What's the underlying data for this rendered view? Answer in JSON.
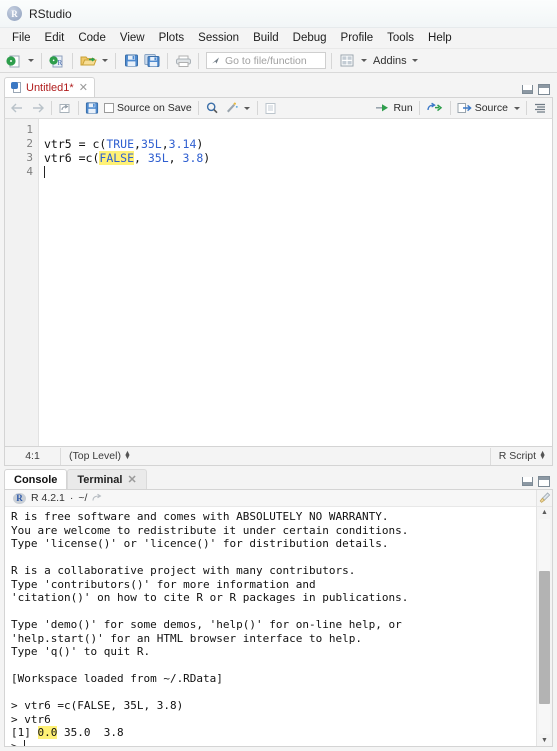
{
  "window": {
    "title": "RStudio",
    "logo_letter": "R"
  },
  "menubar": {
    "items": [
      "File",
      "Edit",
      "Code",
      "View",
      "Plots",
      "Session",
      "Build",
      "Debug",
      "Profile",
      "Tools",
      "Help"
    ]
  },
  "toolbar": {
    "new_file_icon": "new-file-icon",
    "new_project_icon": "new-project-icon",
    "open_file_icon": "open-folder-icon",
    "save_icon": "save-icon",
    "save_all_icon": "save-all-icon",
    "print_icon": "print-icon",
    "goto_placeholder": "Go to file/function",
    "goto_value": "",
    "workspace_panes_icon": "grid-panes-icon",
    "addins_label": "Addins"
  },
  "source_pane": {
    "tab": {
      "label": "Untitled1*",
      "icon": "r-script-doc-icon",
      "close_icon": "close-icon"
    },
    "window_controls": {
      "minimize": "minimize-icon",
      "maximize": "maximize-icon"
    },
    "editor_toolbar": {
      "back_icon": "back-arrow-icon",
      "forward_icon": "forward-arrow-icon",
      "popout_icon": "show-in-new-window-icon",
      "save_icon": "save-icon",
      "source_on_save_label": "Source on Save",
      "find_icon": "search-icon",
      "magic_icon": "code-tools-icon",
      "compile_report_icon": "compile-report-icon",
      "run_label": "Run",
      "rerun_icon": "rerun-icon",
      "source_label": "Source",
      "outline_icon": "document-outline-icon"
    },
    "code_lines": [
      {
        "num": "1",
        "tokens": []
      },
      {
        "num": "2",
        "tokens": [
          {
            "t": "vtr5 = c(",
            "c": "plain"
          },
          {
            "t": "TRUE",
            "c": "logical"
          },
          {
            "t": ",",
            "c": "plain"
          },
          {
            "t": "35L",
            "c": "num"
          },
          {
            "t": ",",
            "c": "plain"
          },
          {
            "t": "3.14",
            "c": "num"
          },
          {
            "t": ")",
            "c": "plain"
          }
        ]
      },
      {
        "num": "3",
        "tokens": [
          {
            "t": "vtr6 =c(",
            "c": "plain"
          },
          {
            "t": "FALSE",
            "c": "logical-highlight"
          },
          {
            "t": ", ",
            "c": "plain"
          },
          {
            "t": "35L",
            "c": "num"
          },
          {
            "t": ", ",
            "c": "plain"
          },
          {
            "t": "3.8",
            "c": "num"
          },
          {
            "t": ")",
            "c": "plain"
          }
        ]
      },
      {
        "num": "4",
        "tokens": [
          {
            "t": "cursor",
            "c": "caret"
          }
        ]
      }
    ],
    "status": {
      "cursor_position": "4:1",
      "scope": "(Top Level)",
      "file_type": "R Script"
    }
  },
  "console_pane": {
    "tabs": [
      {
        "label": "Console",
        "active": true
      },
      {
        "label": "Terminal",
        "active": false,
        "close_icon": "close-icon"
      }
    ],
    "window_controls": {
      "minimize": "minimize-icon",
      "maximize": "maximize-icon"
    },
    "header": {
      "logo": "R",
      "version": "R 4.2.1",
      "separator": "·",
      "working_dir": "~/",
      "popout_icon": "open-in-window-icon"
    },
    "clear_icon": "broom-clear-console-icon",
    "output": [
      "R is free software and comes with ABSOLUTELY NO WARRANTY.",
      "You are welcome to redistribute it under certain conditions.",
      "Type 'license()' or 'licence()' for distribution details.",
      "",
      "R is a collaborative project with many contributors.",
      "Type 'contributors()' for more information and",
      "'citation()' on how to cite R or R packages in publications.",
      "",
      "Type 'demo()' for some demos, 'help()' for on-line help, or",
      "'help.start()' for an HTML browser interface to help.",
      "Type 'q()' to quit R.",
      "",
      "[Workspace loaded from ~/.RData]",
      "",
      "> vtr6 =c(FALSE, 35L, 3.8)",
      "> vtr6"
    ],
    "result_line": {
      "index": "[1] ",
      "highlighted_value": "0.0",
      "rest": " 35.0  3.8"
    },
    "prompt": "> "
  },
  "colors": {
    "accent_blue": "#2f5fd0",
    "highlight_yellow": "#fff176",
    "tab_title_red": "#b01c1c",
    "toolbar_bg": "#f4f4f4",
    "editor_bg": "#ffffff"
  }
}
